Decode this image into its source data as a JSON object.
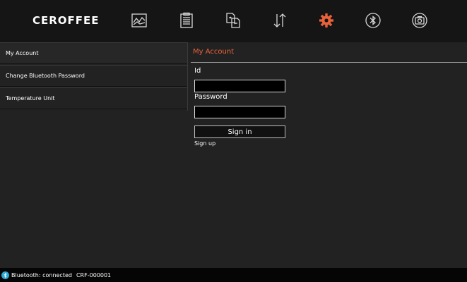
{
  "header": {
    "logo": "CEROFFEE",
    "nav": [
      {
        "icon": "chart-icon"
      },
      {
        "icon": "clipboard-icon"
      },
      {
        "icon": "file-transfer-icon"
      },
      {
        "icon": "sort-arrows-icon"
      },
      {
        "icon": "gear-icon",
        "active": true,
        "color": "#e8623a"
      },
      {
        "icon": "bluetooth-icon"
      },
      {
        "icon": "camera-icon"
      }
    ]
  },
  "sidebar": {
    "items": [
      {
        "label": "My Account"
      },
      {
        "label": "Change Bluetooth Password"
      },
      {
        "label": "Temperature Unit"
      }
    ]
  },
  "main": {
    "title": "My Account",
    "id_label": "Id",
    "id_value": "",
    "password_label": "Password",
    "password_value": "",
    "signin_label": "Sign in",
    "signup_label": "Sign up"
  },
  "status": {
    "bluetooth_text": "Bluetooth: connected",
    "device": "CRF-000001"
  },
  "colors": {
    "accent": "#e8623a",
    "bluetooth": "#2aa8d8"
  }
}
